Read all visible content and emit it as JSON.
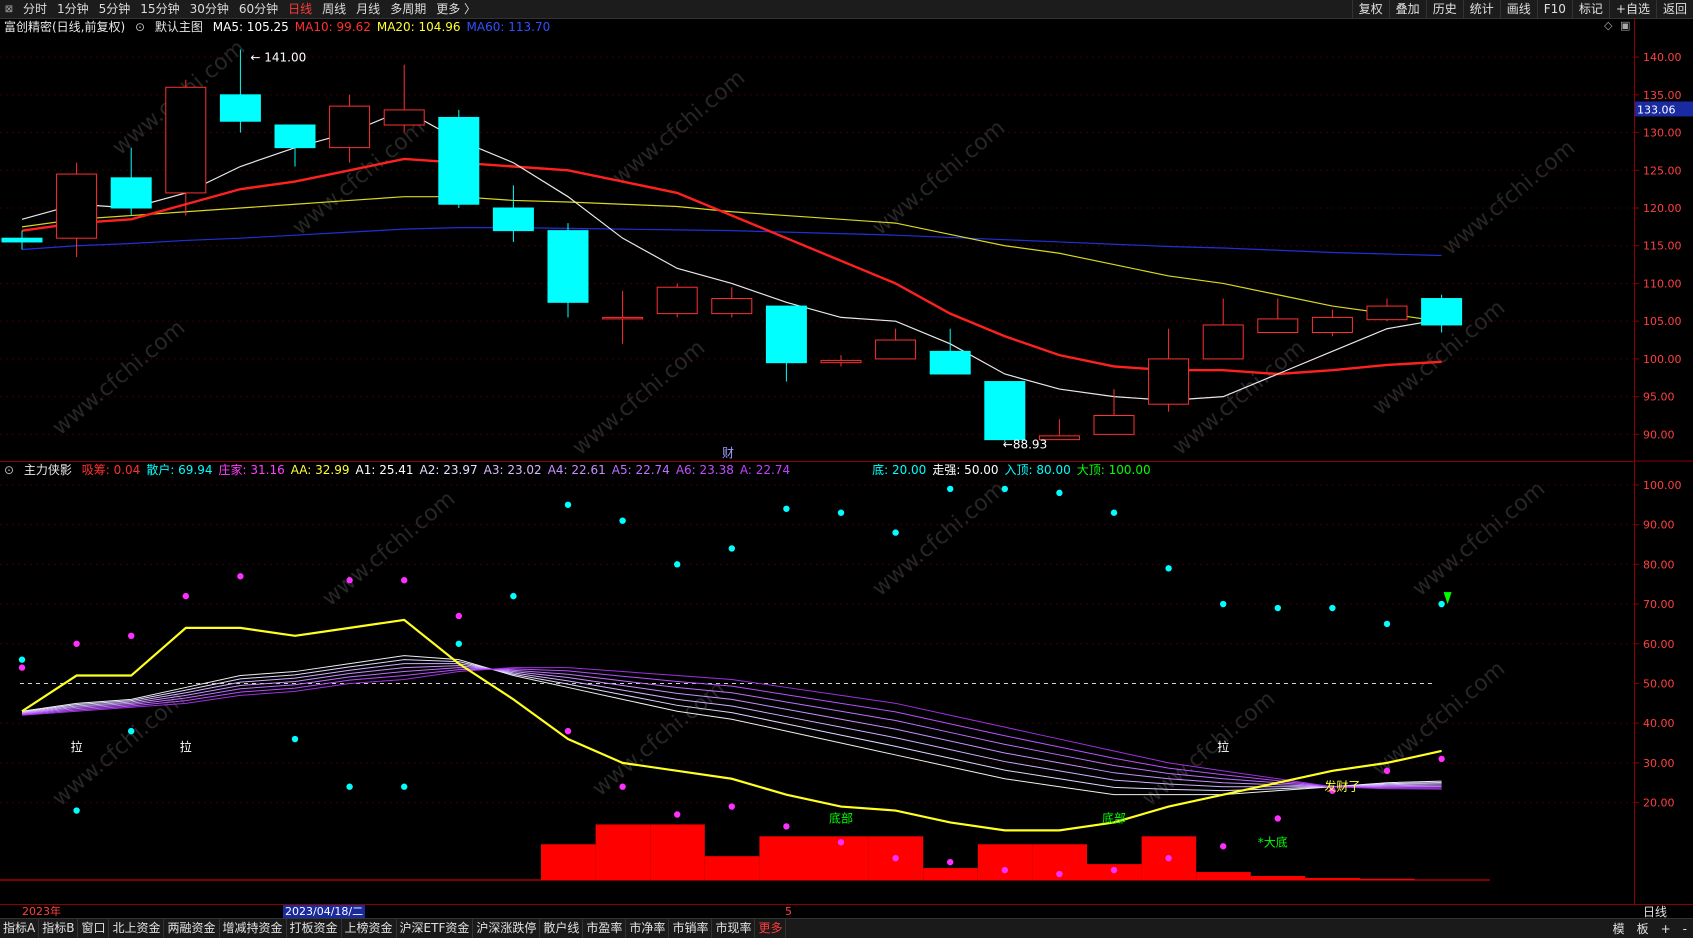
{
  "periods": [
    "分时",
    "1分钟",
    "5分钟",
    "15分钟",
    "30分钟",
    "60分钟",
    "日线",
    "周线",
    "月线",
    "多周期",
    "更多 〉"
  ],
  "active_period": "日线",
  "top_right": [
    "复权",
    "叠加",
    "历史",
    "统计",
    "画线",
    "F10",
    "标记",
    "+自选",
    "返回"
  ],
  "main_header": {
    "stock": "富创精密(日线,前复权)",
    "chart_label": "默认主图",
    "ma": [
      {
        "label": "MA5: 105.25",
        "color": "#ffffff"
      },
      {
        "label": "MA10: 99.62",
        "color": "#ff3030"
      },
      {
        "label": "MA20: 104.96",
        "color": "#ffff33"
      },
      {
        "label": "MA60: 113.70",
        "color": "#3050ff"
      }
    ]
  },
  "price_axis": {
    "ticks": [
      "140.00",
      "135.00",
      "130.00",
      "125.00",
      "120.00",
      "115.00",
      "110.00",
      "105.00",
      "100.00",
      "95.00",
      "90.00"
    ],
    "current": "133.06"
  },
  "annotations": {
    "high": "141.00",
    "low": "88.93",
    "cai": "财"
  },
  "candles": [
    {
      "o": 116,
      "c": 115.5,
      "h": 117,
      "l": 114.5
    },
    {
      "o": 116,
      "c": 124.5,
      "h": 126,
      "l": 113.5
    },
    {
      "o": 124,
      "c": 120,
      "h": 128,
      "l": 119
    },
    {
      "o": 122,
      "c": 136,
      "h": 137,
      "l": 119
    },
    {
      "o": 135,
      "c": 131.5,
      "h": 141,
      "l": 130
    },
    {
      "o": 131,
      "c": 128,
      "h": 131,
      "l": 125.5
    },
    {
      "o": 128,
      "c": 133.5,
      "h": 135,
      "l": 126
    },
    {
      "o": 131,
      "c": 133,
      "h": 139,
      "l": 130
    },
    {
      "o": 132,
      "c": 120.5,
      "h": 133,
      "l": 120
    },
    {
      "o": 120,
      "c": 117,
      "h": 123,
      "l": 115.5
    },
    {
      "o": 117,
      "c": 107.5,
      "h": 118,
      "l": 105.5
    },
    {
      "o": 105.5,
      "c": 105.5,
      "h": 109,
      "l": 102
    },
    {
      "o": 106,
      "c": 109.5,
      "h": 110,
      "l": 105.5
    },
    {
      "o": 106,
      "c": 108,
      "h": 109.5,
      "l": 105.5
    },
    {
      "o": 107,
      "c": 99.5,
      "h": 107,
      "l": 97
    },
    {
      "o": 99.5,
      "c": 99.8,
      "h": 100.5,
      "l": 99
    },
    {
      "o": 100,
      "c": 102.5,
      "h": 104,
      "l": 100
    },
    {
      "o": 101,
      "c": 98,
      "h": 104,
      "l": 98
    },
    {
      "o": 97,
      "c": 89.3,
      "h": 97,
      "l": 88.93
    },
    {
      "o": 89.3,
      "c": 89.8,
      "h": 92,
      "l": 89.3
    },
    {
      "o": 90,
      "c": 92.5,
      "h": 96,
      "l": 90
    },
    {
      "o": 94,
      "c": 100,
      "h": 104,
      "l": 93
    },
    {
      "o": 100,
      "c": 104.5,
      "h": 108,
      "l": 100
    },
    {
      "o": 103.5,
      "c": 105.3,
      "h": 108,
      "l": 103.5
    },
    {
      "o": 103.5,
      "c": 105.5,
      "h": 106.5,
      "l": 103
    },
    {
      "o": 105.2,
      "c": 107,
      "h": 108,
      "l": 105
    },
    {
      "o": 108,
      "c": 104.5,
      "h": 108.5,
      "l": 103.5
    }
  ],
  "ma_lines": {
    "ma5": [
      118.5,
      120.5,
      120,
      122,
      125.5,
      128,
      130,
      133,
      129,
      126,
      121.5,
      116,
      112,
      110,
      107.5,
      105.5,
      105,
      102,
      98,
      96,
      95,
      94.5,
      95,
      98,
      101,
      104,
      105.25
    ],
    "ma10": [
      117,
      118,
      118.5,
      120.5,
      122.5,
      123.5,
      125,
      126.5,
      126,
      125.5,
      125,
      123.5,
      122,
      119,
      116,
      113,
      110,
      106,
      103,
      100.5,
      99,
      98.5,
      98.5,
      98,
      98.5,
      99.2,
      99.62
    ],
    "ma20": [
      117.5,
      118.5,
      119,
      119.5,
      120,
      120.5,
      121,
      121.5,
      121.5,
      121,
      120.8,
      120.5,
      120.2,
      119.5,
      119,
      118.5,
      118,
      116.5,
      115,
      114,
      112.5,
      111,
      110,
      108.5,
      107,
      106,
      104.96
    ],
    "ma60": [
      114.5,
      115,
      115.3,
      115.7,
      116,
      116.4,
      116.8,
      117.2,
      117.4,
      117.4,
      117.3,
      117.2,
      117.1,
      117,
      116.8,
      116.6,
      116.4,
      116.1,
      115.8,
      115.5,
      115.2,
      114.9,
      114.7,
      114.4,
      114.1,
      113.9,
      113.7
    ]
  },
  "indicator_header": {
    "title": "主力侠影",
    "items": [
      {
        "label": "吸筹: 0.04",
        "color": "#ff3030"
      },
      {
        "label": "散户: 69.94",
        "color": "#00ffff"
      },
      {
        "label": "庄家: 31.16",
        "color": "#ff40ff"
      },
      {
        "label": "AA: 32.99",
        "color": "#ffff33"
      },
      {
        "label": "A1: 25.41",
        "color": "#ffffff"
      },
      {
        "label": "A2: 23.97",
        "color": "#e0e0ff"
      },
      {
        "label": "A3: 23.02",
        "color": "#d8b8ff"
      },
      {
        "label": "A4: 22.61",
        "color": "#c890ff"
      },
      {
        "label": "A5: 22.74",
        "color": "#c070ff"
      },
      {
        "label": "A6: 23.38",
        "color": "#c050ff"
      },
      {
        "label": "A: 22.74",
        "color": "#c040ff"
      }
    ],
    "items2": [
      {
        "label": "底: 20.00",
        "color": "#00ffff"
      },
      {
        "label": "走强: 50.00",
        "color": "#ffffff"
      },
      {
        "label": "入顶: 80.00",
        "color": "#00ffff"
      },
      {
        "label": "大顶: 100.00",
        "color": "#00ff00"
      }
    ]
  },
  "ind_axis": [
    "100.00",
    "90.00",
    "80.00",
    "70.00",
    "60.00",
    "50.00",
    "40.00",
    "30.00",
    "20.00"
  ],
  "indicator": {
    "aa": [
      43,
      52,
      52,
      64,
      64,
      62,
      64,
      66,
      55,
      46,
      36,
      30,
      28,
      26,
      22,
      19,
      18,
      15,
      13,
      13,
      15,
      19,
      22,
      25,
      28,
      30,
      33
    ],
    "a1": [
      43,
      45,
      46,
      49,
      52,
      53,
      55,
      57,
      56,
      52,
      49,
      46,
      43,
      41,
      38,
      35,
      32,
      29,
      26,
      24,
      22,
      22,
      22,
      23,
      24,
      25,
      25.41
    ],
    "a6": [
      42,
      43,
      44,
      45,
      47,
      48,
      50,
      51,
      53,
      54,
      54,
      53,
      52,
      51,
      49,
      47,
      45,
      42,
      39,
      36,
      33,
      30,
      28,
      26,
      24,
      23.5,
      23.38
    ],
    "cyan": [
      56,
      18,
      38,
      null,
      null,
      36,
      24,
      24,
      60,
      72,
      95,
      91,
      80,
      84,
      94,
      93,
      88,
      99,
      99,
      98,
      93,
      79,
      70,
      69,
      69,
      65,
      70
    ],
    "mag": [
      54,
      60,
      62,
      72,
      77,
      null,
      76,
      76,
      67,
      null,
      38,
      24,
      17,
      19,
      14,
      10,
      6,
      5,
      3,
      2,
      3,
      6,
      9,
      16,
      23,
      28,
      31
    ],
    "red_bars": [
      0,
      0,
      0,
      0,
      0,
      0,
      0,
      0,
      0,
      0,
      9,
      14,
      14,
      6,
      11,
      11,
      11,
      3,
      9,
      9,
      4,
      11,
      2,
      1,
      0.5,
      0.3,
      0
    ],
    "la": [
      {
        "i": 1,
        "v": 33,
        "t": "拉"
      },
      {
        "i": 3,
        "v": 33,
        "t": "拉"
      },
      {
        "i": 22,
        "v": 33,
        "t": "拉"
      }
    ],
    "dibu": [
      {
        "i": 15,
        "v": 15,
        "t": "底部"
      },
      {
        "i": 20,
        "v": 15,
        "t": "底部"
      }
    ],
    "dadi": "*大底",
    "facai": "发财了"
  },
  "date_axis": {
    "year": "2023年",
    "cursor": "2023/04/18/二",
    "month_mark": "5",
    "right": "日线"
  },
  "bottom_tabs": [
    "指标A",
    "指标B",
    "窗口",
    "北上资金",
    "两融资金",
    "增减持资金",
    "打板资金",
    "上榜资金",
    "沪深ETF资金",
    "沪深涨跌停",
    "散户线",
    "市盈率",
    "市净率",
    "市销率",
    "市现率",
    "更多"
  ],
  "bottom_right": [
    "模",
    "板",
    "+",
    "-"
  ],
  "watermark": "www.cfchi.com"
}
